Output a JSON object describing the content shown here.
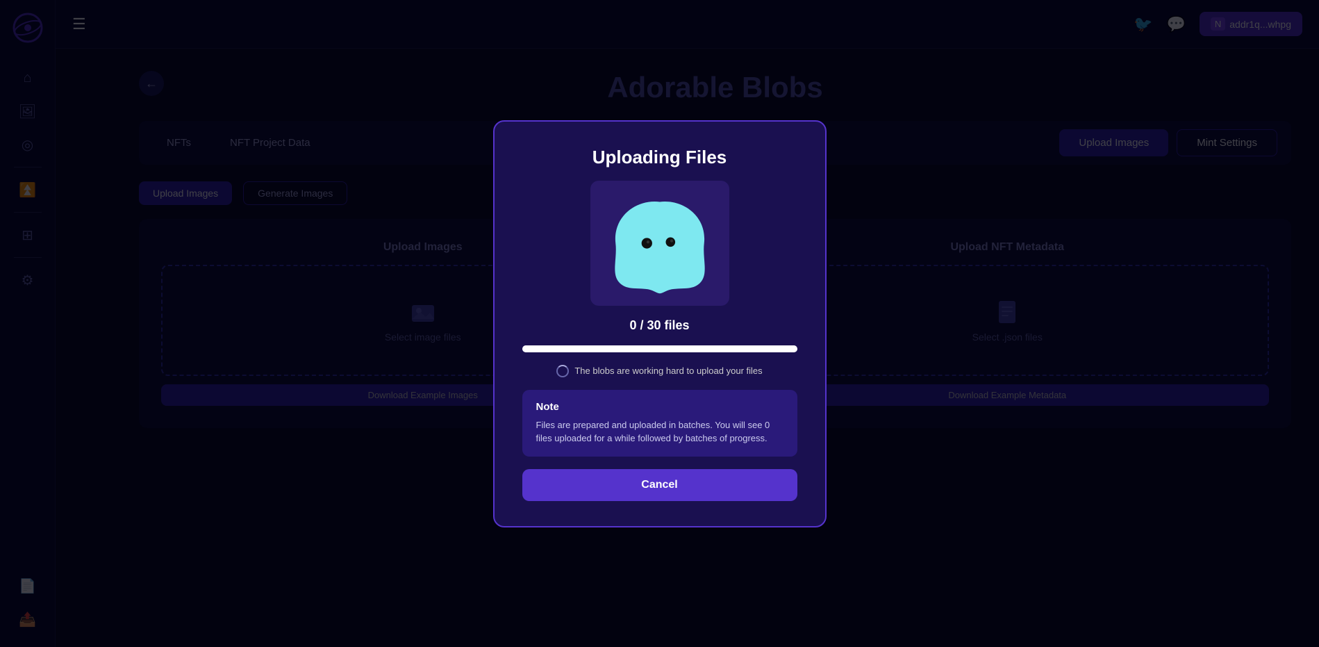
{
  "app": {
    "logo_alt": "Planet Logo"
  },
  "sidebar": {
    "icons": [
      {
        "name": "home-icon",
        "symbol": "⌂"
      },
      {
        "name": "image-icon",
        "symbol": "🖼"
      },
      {
        "name": "target-icon",
        "symbol": "◎"
      },
      {
        "name": "chevron-up-icon",
        "symbol": "⏫"
      },
      {
        "name": "grid-icon",
        "symbol": "⊞"
      },
      {
        "name": "settings-icon",
        "symbol": "⚙"
      },
      {
        "name": "document-icon",
        "symbol": "📄"
      },
      {
        "name": "export-icon",
        "symbol": "📤"
      }
    ]
  },
  "header": {
    "hamburger_label": "☰",
    "twitter_label": "🐦",
    "discord_label": "💬",
    "wallet_network": "N",
    "wallet_address": "addr1q...whpg"
  },
  "page": {
    "title": "Adorable Blobs",
    "back_label": "←"
  },
  "tabs": {
    "left": [
      {
        "label": "NFTs",
        "active": false
      },
      {
        "label": "NFT Project Data",
        "active": false
      }
    ],
    "right": [
      {
        "label": "Upload Images",
        "active": true
      },
      {
        "label": "Mint Settings",
        "active": false
      }
    ]
  },
  "sub_tabs": [
    {
      "label": "Upload Images",
      "active": true
    },
    {
      "label": "Generate Images",
      "active": false
    }
  ],
  "upload_section": {
    "images_title": "Upload Images",
    "metadata_title": "Upload NFT Metadata",
    "images_dropzone_text": "Select image files",
    "metadata_dropzone_text": "Select .json files",
    "download_images_btn": "Download Example Images",
    "download_metadata_btn": "Download Example Metadata"
  },
  "modal": {
    "title": "Uploading Files",
    "file_count": "0 / 30 files",
    "progress_percent": 100,
    "status_text": "The blobs are working hard to upload your files",
    "note_title": "Note",
    "note_text": "Files are prepared and uploaded in batches. You will see 0 files uploaded for a while followed by batches of progress.",
    "cancel_label": "Cancel"
  }
}
